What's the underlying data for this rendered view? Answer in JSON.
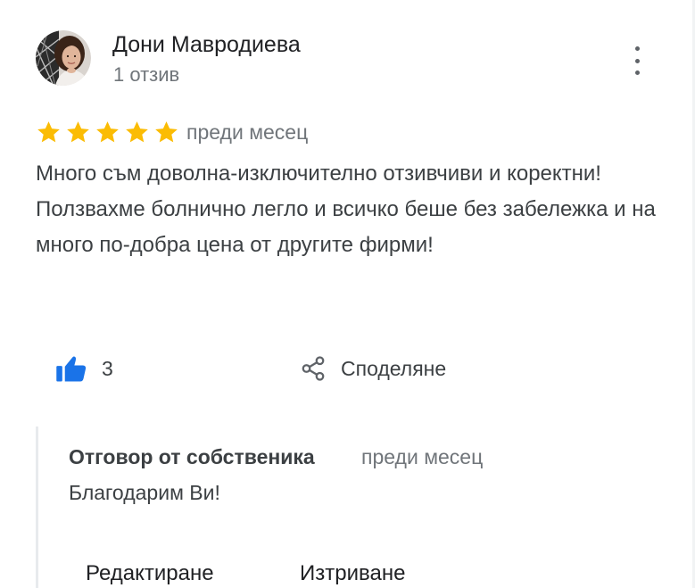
{
  "review": {
    "reviewer_name": "Дони Мавродиева",
    "reviewer_meta": "1 отзив",
    "rating": 5,
    "rating_max": 5,
    "date": "преди месец",
    "text": "Много съм доволна-изключително отзивчиви и коректни! Ползвахме болнично легло и всичко беше без забележка и на много по-добра цена от другите фирми!",
    "avatar_icon": "profile-photo",
    "more_icon": "more-vert-icon"
  },
  "actions": {
    "like_count": "3",
    "like_icon": "thumb-up-icon",
    "share_label": "Споделяне",
    "share_icon": "share-icon"
  },
  "owner_reply": {
    "title": "Отговор от собственика",
    "date": "преди месец",
    "text": "Благодарим Ви!",
    "edit_label": "Редактиране",
    "delete_label": "Изтриване"
  },
  "colors": {
    "star": "#fbbc04",
    "like_icon": "#1a73e8",
    "text_primary": "#202124",
    "text_secondary": "#70757a",
    "reply_border": "#e8eaed"
  }
}
